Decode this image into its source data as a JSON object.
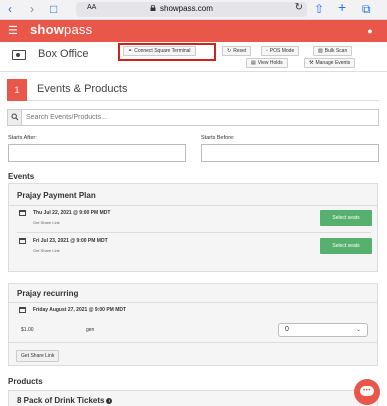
{
  "browser": {
    "url": "showpass.com",
    "aa": "AA"
  },
  "app": {
    "logo_bold": "show",
    "logo_light": "pass"
  },
  "boxoffice": {
    "title": "Box Office",
    "buttons": {
      "connect": "Connect Square Terminal",
      "reset": "Reset",
      "pos": "POS Mode",
      "bulk": "Bulk Scan",
      "holds": "View Holds",
      "manage": "Manage Events"
    }
  },
  "section": {
    "number": "1",
    "title": "Events & Products"
  },
  "search": {
    "placeholder": "Search Events/Products..."
  },
  "filters": {
    "after_label": "Starts After:",
    "before_label": "Starts Before:"
  },
  "events_heading": "Events",
  "event1": {
    "title": "Prajay Payment Plan",
    "rows": [
      {
        "date": "Thu Jul 22, 2021 @ 9:00 PM MDT",
        "share": "Get Share Link",
        "action": "Select seats"
      },
      {
        "date": "Fri Jul 23, 2021 @ 9:00 PM MDT",
        "share": "Get Share Link",
        "action": "Select seats"
      }
    ]
  },
  "event2": {
    "title": "Prajay recurring",
    "date": "Friday August 27, 2021 @ 9:00 PM MDT",
    "price": "$1.00",
    "ticket": "gen",
    "qty": "0",
    "share_btn": "Get Share Link"
  },
  "products_heading": "Products",
  "product1": {
    "title": "8 Pack of Drink Tickets"
  }
}
